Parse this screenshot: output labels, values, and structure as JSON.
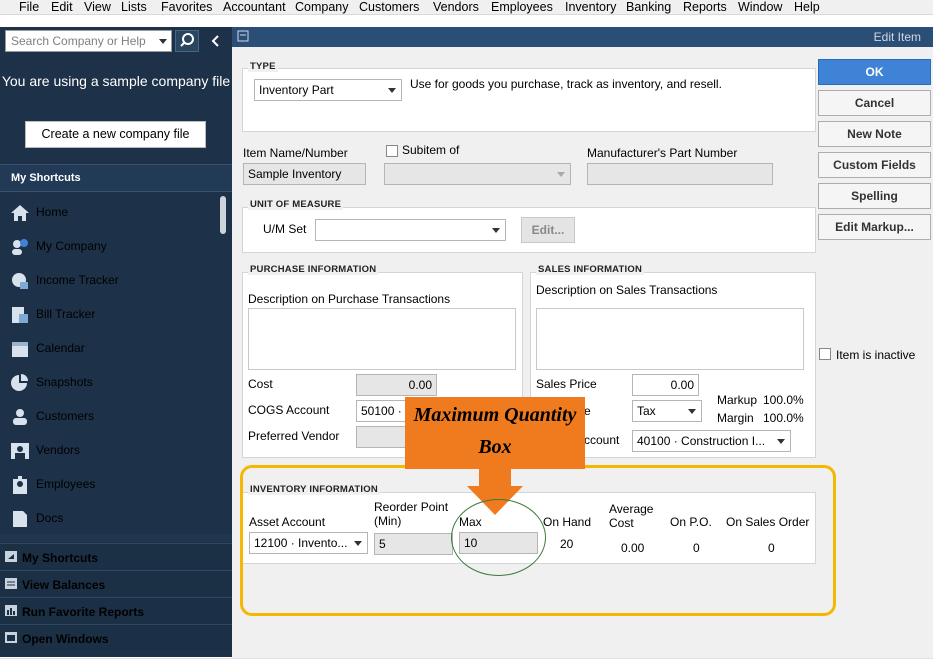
{
  "menu": [
    "File",
    "Edit",
    "View",
    "Lists",
    "Favorites",
    "Accountant",
    "Company",
    "Customers",
    "Vendors",
    "Employees",
    "Inventory",
    "Banking",
    "Reports",
    "Window",
    "Help"
  ],
  "sidebar": {
    "search_placeholder": "Search Company or Help",
    "sample_message": "You are using a sample company file",
    "create_button": "Create a new company file",
    "shortcuts_header": "My Shortcuts",
    "items": [
      {
        "label": "Home",
        "icon": "home-icon"
      },
      {
        "label": "My Company",
        "icon": "company-icon"
      },
      {
        "label": "Income Tracker",
        "icon": "income-tracker-icon"
      },
      {
        "label": "Bill Tracker",
        "icon": "bill-tracker-icon"
      },
      {
        "label": "Calendar",
        "icon": "calendar-icon"
      },
      {
        "label": "Snapshots",
        "icon": "pie-chart-icon"
      },
      {
        "label": "Customers",
        "icon": "person-icon"
      },
      {
        "label": "Vendors",
        "icon": "vendor-icon"
      },
      {
        "label": "Employees",
        "icon": "employee-icon"
      },
      {
        "label": "Docs",
        "icon": "document-icon"
      }
    ],
    "bottom_nav": [
      "My Shortcuts",
      "View Balances",
      "Run Favorite Reports",
      "Open Windows"
    ]
  },
  "dialog": {
    "title": "Edit Item",
    "type_section": "TYPE",
    "type_value": "Inventory Part",
    "type_description": "Use for goods you purchase, track as inventory, and resell.",
    "item_name_label": "Item Name/Number",
    "item_name_value": "Sample Inventory",
    "subitem_label": "Subitem of",
    "mfr_label": "Manufacturer's Part Number",
    "um_section": "UNIT OF MEASURE",
    "um_set_label": "U/M Set",
    "um_edit_button": "Edit...",
    "purchase_section": "PURCHASE INFORMATION",
    "purchase_desc_label": "Description on Purchase Transactions",
    "cost_label": "Cost",
    "cost_value": "0.00",
    "cogs_label": "COGS Account",
    "cogs_value": "50100 · ",
    "pref_vendor_label": "Preferred Vendor",
    "sales_section": "SALES INFORMATION",
    "sales_desc_label": "Description on Sales Transactions",
    "sales_price_label": "Sales Price",
    "sales_price_value": "0.00",
    "tax_label_partial": "e",
    "tax_value": "Tax",
    "markup_label": "Markup",
    "markup_value": "100.0%",
    "margin_label": "Margin",
    "margin_value": "100.0%",
    "income_label_partial": "ccount",
    "income_value": "40100 · Construction I...",
    "inventory_section": "INVENTORY INFORMATION",
    "asset_label": "Asset Account",
    "asset_value": "12100 · Invento...",
    "reorder_label": "Reorder Point (Min)",
    "reorder_value": "5",
    "max_label": "Max",
    "max_value": "10",
    "on_hand_label": "On Hand",
    "on_hand_value": "20",
    "avg_cost_label": "Average Cost",
    "avg_cost_value": "0.00",
    "on_po_label": "On P.O.",
    "on_po_value": "0",
    "on_sales_label": "On Sales Order",
    "on_sales_value": "0",
    "inactive_label": "Item is inactive",
    "buttons": {
      "ok": "OK",
      "cancel": "Cancel",
      "new_note": "New Note",
      "custom_fields": "Custom Fields",
      "spelling": "Spelling",
      "edit_markup": "Edit Markup..."
    }
  },
  "annotation": {
    "callout": "Maximum Quantity Box",
    "highlight_color": "#f5b800",
    "callout_color": "#f07b1e"
  }
}
